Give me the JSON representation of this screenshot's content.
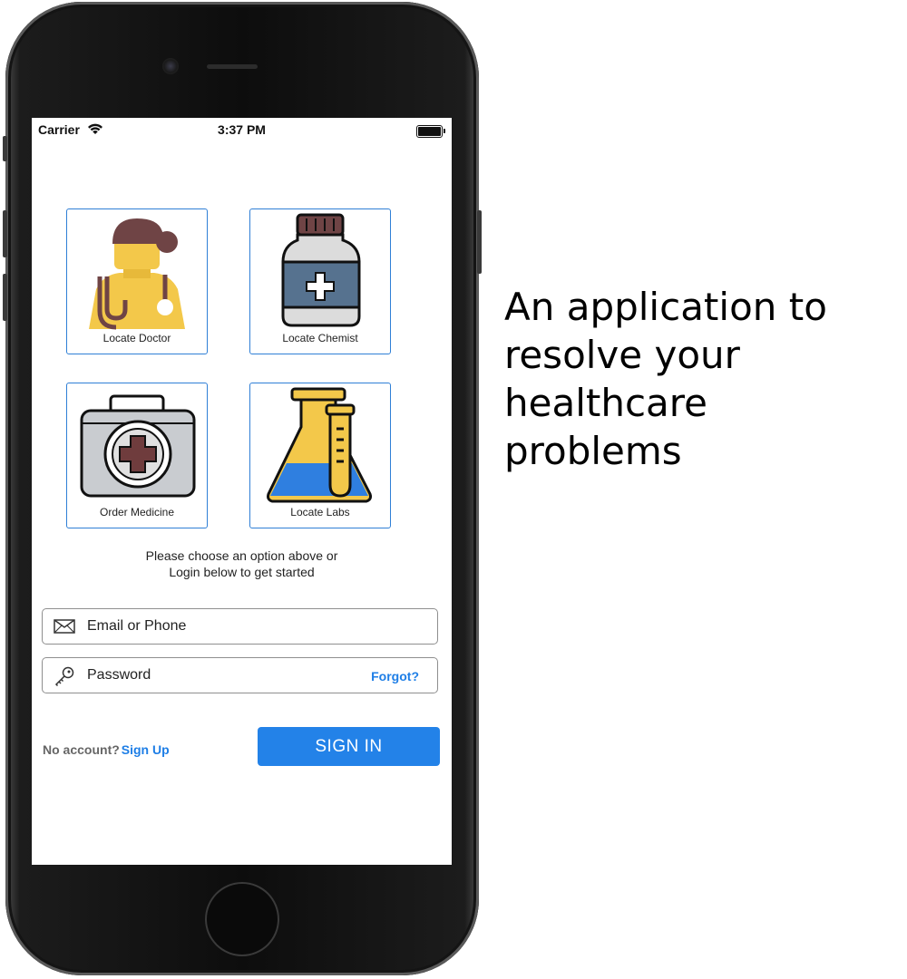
{
  "status_bar": {
    "carrier": "Carrier",
    "time": "3:37 PM"
  },
  "tiles": [
    {
      "label": "Locate Doctor",
      "icon": "doctor-icon"
    },
    {
      "label": "Locate Chemist",
      "icon": "medicine-bottle-icon"
    },
    {
      "label": "Order Medicine",
      "icon": "first-aid-kit-icon"
    },
    {
      "label": "Locate Labs",
      "icon": "lab-flask-icon"
    }
  ],
  "help_text": {
    "line1": "Please choose an option above or",
    "line2": "Login below to get started"
  },
  "login": {
    "email_placeholder": "Email or Phone",
    "password_placeholder": "Password",
    "forgot_label": "Forgot?",
    "no_account_label": "No account?",
    "signup_label": "Sign Up",
    "signin_label": "SIGN IN"
  },
  "tagline": [
    "An application to",
    "resolve your",
    "healthcare",
    "problems"
  ],
  "colors": {
    "accent": "#2382e8",
    "tile_border": "#2f7fd6",
    "link": "#1e7ee6"
  }
}
